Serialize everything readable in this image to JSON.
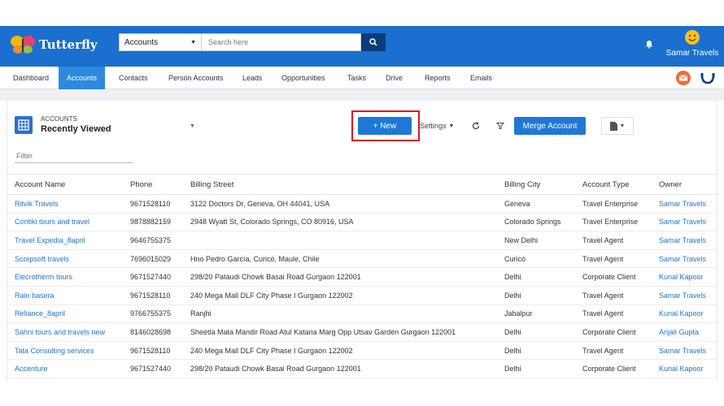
{
  "app": {
    "name": "Tutterfly"
  },
  "search": {
    "object": "Accounts",
    "placeholder": "Search here"
  },
  "user": {
    "name": "Samar Travels"
  },
  "nav": {
    "items": [
      "Dashboard",
      "Accounts",
      "Contacts",
      "Person Accounts",
      "Leads",
      "Opportunities",
      "Tasks",
      "Drive",
      "Reports",
      "Emails"
    ],
    "active": "Accounts"
  },
  "list": {
    "object_label": "ACCOUNTS",
    "view_name": "Recently Viewed",
    "new_label": "+ New",
    "settings_label": "Settings",
    "merge_label": "Merge Account",
    "filter_placeholder": "Filter"
  },
  "table": {
    "columns": [
      "Account Name",
      "Phone",
      "Billing Street",
      "Billing City",
      "Account Type",
      "Owner"
    ],
    "rows": [
      [
        "Ritvik Travels",
        "9671528110",
        "3122 Doctors Dr, Geneva, OH 44041, USA",
        "Geneva",
        "Travel Enterprise",
        "Samar Travels"
      ],
      [
        "Contiki tours and travel",
        "9878882159",
        "2948 Wyatt St, Colorado Springs, CO 80916, USA",
        "Colorado Springs",
        "Travel Enterprise",
        "Samar Travels"
      ],
      [
        "Travel Expedia_8april",
        "9646755375",
        "",
        "New Delhi",
        "Travel Agent",
        "Samar Travels"
      ],
      [
        "Scorpsoft travels",
        "7696015029",
        "Hno Pedro García, Curicó, Maule, Chile",
        "Curicó",
        "Travel Agent",
        "Samar Travels"
      ],
      [
        "Elecrotherm tours",
        "9671527440",
        "298/20 Pataudi Chowk Basai Road Gurgaon 122001",
        "Delhi",
        "Corporate Client",
        "Kunal Kapoor"
      ],
      [
        "Rain basera",
        "9671528110",
        "240 Mega Mall DLF City Phase I Gurgaon 122002",
        "Delhi",
        "Travel Agent",
        "Samar Travels"
      ],
      [
        "Reliance_8april",
        "9766755375",
        "Ranjhi",
        "Jabalpur",
        "Travel Agent",
        "Kunal Kapoor"
      ],
      [
        "Sahni tours and travels new",
        "8146028698",
        "Sheetla Mata Mandir Road Atul Kataria Marg Opp Utsav Garden Gurgaon 122001",
        "Delhi",
        "Corporate Client",
        "Anjali Gupta"
      ],
      [
        "Tata Consulting services",
        "9671528110",
        "240 Mega Mall DLF City Phase I Gurgaon 122002",
        "Delhi",
        "Travel Agent",
        "Samar Travels"
      ],
      [
        "Accenture",
        "9671527440",
        "298/20 Pataudi Chowk Basai Road Gurgaon 122001",
        "Delhi",
        "Corporate Client",
        "Kunal Kapoor"
      ]
    ]
  },
  "colors": {
    "header": "#1a6fcf",
    "accent": "#1f78d7",
    "link": "#2274cf",
    "highlight": "#e0161c"
  },
  "icons": [
    "butterfly-logo-icon",
    "search-icon",
    "bell-icon",
    "user-avatar-icon",
    "mail-icon",
    "headset-icon",
    "account-list-icon",
    "refresh-icon",
    "filter-icon",
    "file-icon"
  ]
}
